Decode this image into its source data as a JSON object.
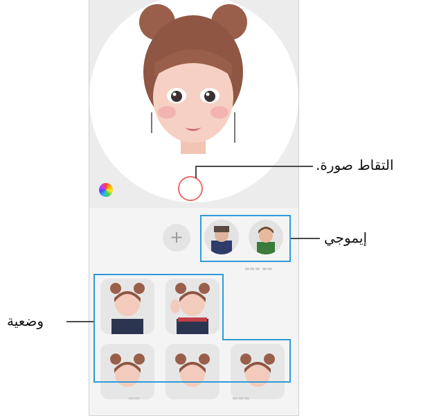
{
  "labels": {
    "capture": "التقاط صورة.",
    "emoji": "إيموجي",
    "pose": "وضعية"
  },
  "emoji_panel": {
    "add_symbol": "+"
  },
  "colors": {
    "highlight": "#2d9bd7",
    "shutter_ring": "#ef6b6b",
    "camera_icon": "#e8505b"
  },
  "icons": [
    "color-wheel-icon",
    "plus-icon",
    "camera-icon"
  ]
}
